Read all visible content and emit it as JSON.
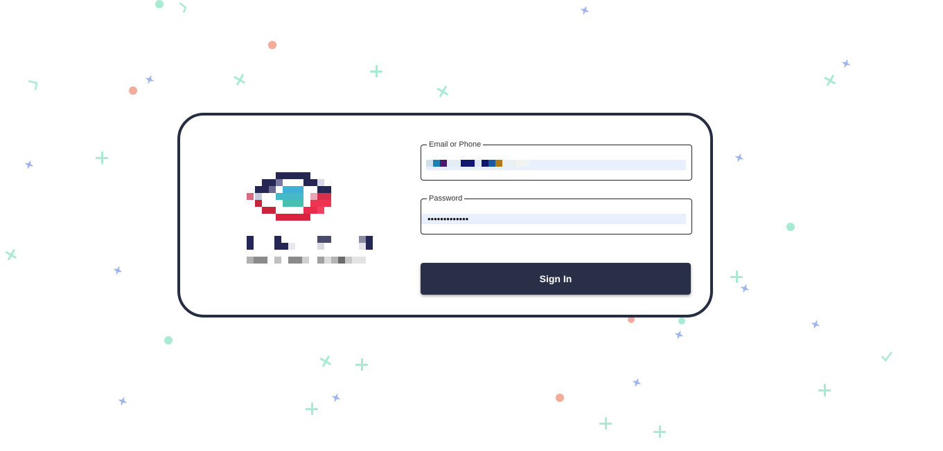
{
  "login": {
    "email_legend": "Email or Phone",
    "email_value": "",
    "password_legend": "Password",
    "password_value": "•••••••••••••",
    "signin_label": "Sign In"
  },
  "colors": {
    "card_border": "#262c41",
    "button": "#2a2f48",
    "input_autofill": "#e8f0fe",
    "confetti_green": "#a8ead2",
    "confetti_salmon": "#f3ab9a",
    "confetti_blue": "#9fb3ee"
  },
  "icons": {
    "logo": "eye-logo-icon",
    "confetti": [
      "dot",
      "plus",
      "sparkle",
      "chevron",
      "check"
    ]
  }
}
